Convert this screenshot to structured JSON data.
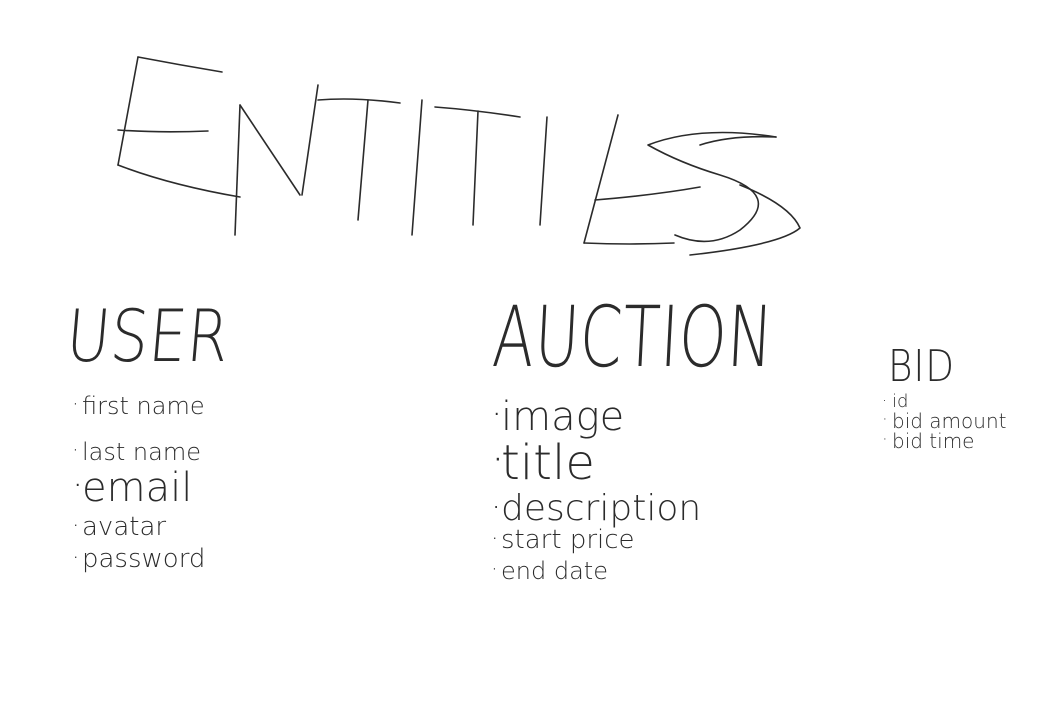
{
  "title": "ENTITIES",
  "entities": {
    "user": {
      "name": "USER",
      "attributes": [
        "first name",
        "last name",
        "email",
        "avatar",
        "password"
      ]
    },
    "auction": {
      "name": "AUCTION",
      "attributes": [
        "image",
        "title",
        "description",
        "start price",
        "end date"
      ]
    },
    "bid": {
      "name": "BID",
      "attributes": [
        "id",
        "bid amount",
        "bid time"
      ]
    }
  }
}
